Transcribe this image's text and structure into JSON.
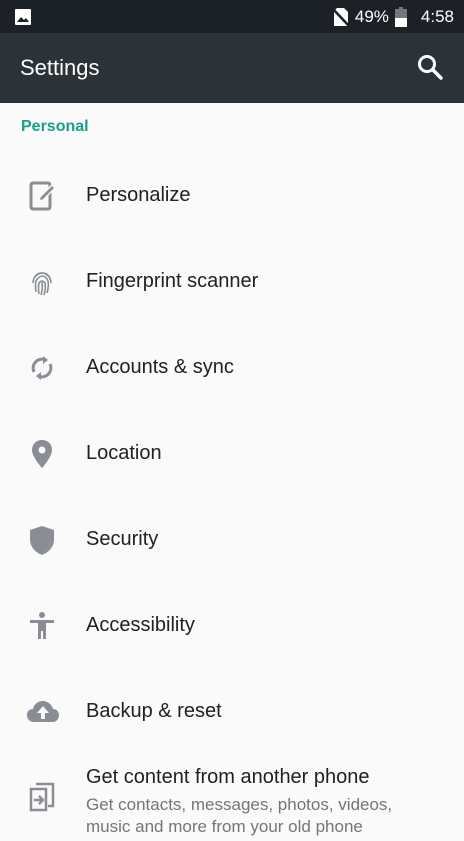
{
  "status_bar": {
    "battery_percent": "49%",
    "time": "4:58",
    "icons": [
      "image-icon",
      "no-sim-icon",
      "battery-icon"
    ]
  },
  "app_bar": {
    "title": "Settings",
    "search_icon": "search-icon"
  },
  "section": {
    "title": "Personal"
  },
  "items": [
    {
      "label": "Personalize",
      "icon": "personalize-icon"
    },
    {
      "label": "Fingerprint scanner",
      "icon": "fingerprint-icon"
    },
    {
      "label": "Accounts & sync",
      "icon": "sync-icon"
    },
    {
      "label": "Location",
      "icon": "location-pin-icon"
    },
    {
      "label": "Security",
      "icon": "shield-icon"
    },
    {
      "label": "Accessibility",
      "icon": "accessibility-icon"
    },
    {
      "label": "Backup & reset",
      "icon": "cloud-upload-icon"
    },
    {
      "label": "Get content from another phone",
      "subtitle": "Get contacts, messages, photos, videos, music and more from your old phone",
      "icon": "transfer-icon"
    }
  ],
  "colors": {
    "accent": "#1a9e8c",
    "app_bar": "#2b3238",
    "status_bar": "#1c2127",
    "icon": "#8a8d96"
  }
}
